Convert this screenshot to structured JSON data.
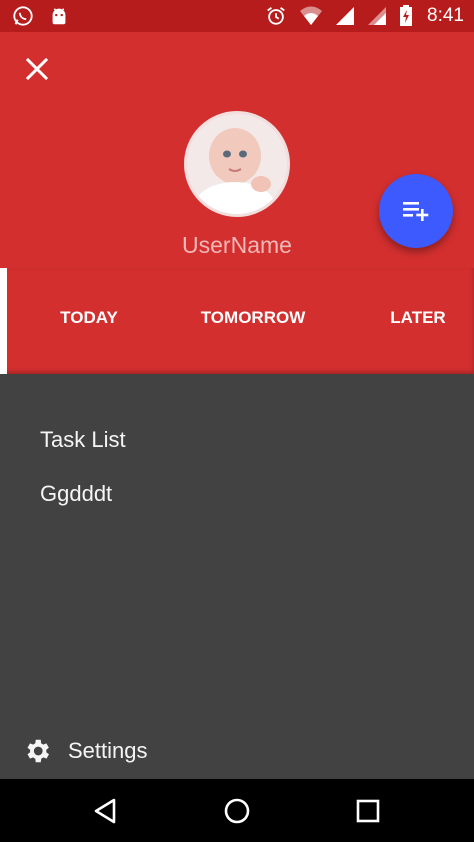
{
  "status_bar": {
    "time": "8:41",
    "left_icons": [
      "whatsapp-icon",
      "android-icon"
    ],
    "right_icons": [
      "alarm-icon",
      "wifi-icon",
      "signal-icon",
      "signal-icon",
      "battery-charging-icon"
    ]
  },
  "header": {
    "username": "UserName",
    "close_icon": "close-icon",
    "fab_icon": "playlist-add-icon"
  },
  "tabs": [
    {
      "label": "TODAY"
    },
    {
      "label": "TOMORROW"
    },
    {
      "label": "LATER"
    }
  ],
  "drawer": {
    "items": [
      {
        "label": "Task List"
      },
      {
        "label": "Ggdddt"
      }
    ],
    "settings_label": "Settings"
  },
  "colors": {
    "status_bar": "#b71c1c",
    "primary": "#d32f2f",
    "fab": "#3d5afe",
    "drawer_bg": "#424242",
    "nav_bar": "#000000"
  }
}
